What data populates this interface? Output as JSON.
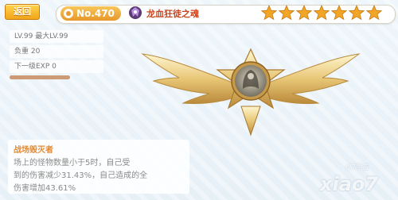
{
  "header": {
    "back_label": "返回",
    "number": "No.470",
    "soul_name": "龙血狂徒之魂",
    "star_count": 7,
    "star_color": "#f3a526"
  },
  "stats": {
    "level": "LV.99 最大LV.99",
    "load": "负重 20",
    "next_exp": "下一级EXP 0",
    "exp_fraction": 1.0
  },
  "skill": {
    "title": "战场毁灭者",
    "lines": [
      "场上的怪物数量小于5时，自己受",
      "到的伤害减少31.43%，自己造成的全",
      "伤害增加43.61%"
    ]
  },
  "watermark": {
    "main": "xiao7",
    "small": "小7手游"
  },
  "colors": {
    "accent": "#f2a51a",
    "skill_title": "#e5892e",
    "soul_name": "#c8441d"
  }
}
